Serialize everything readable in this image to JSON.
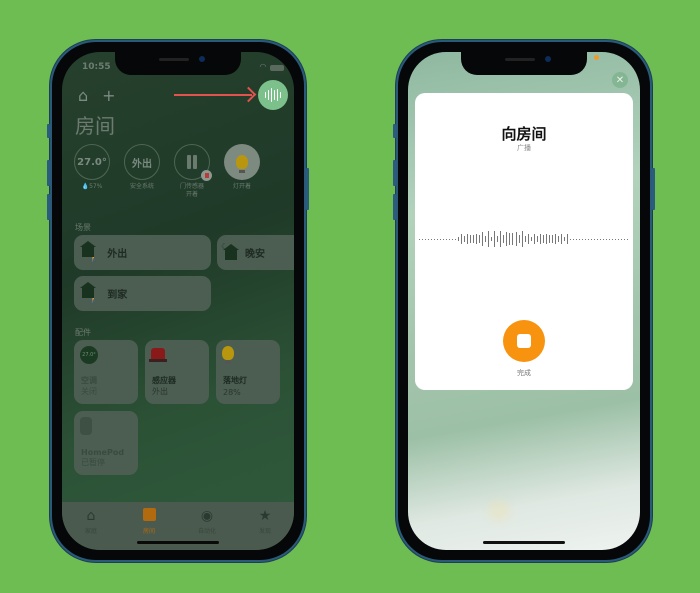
{
  "left_phone": {
    "status_bar": {
      "time": "10:55"
    },
    "header": {
      "home_icon": "house-icon",
      "add_icon": "plus-icon",
      "voice_icon": "waveform-icon",
      "title": "房间"
    },
    "status_items": [
      {
        "value": "27.0°",
        "label": "💧57%"
      },
      {
        "value": "外出",
        "label": "安全系统"
      },
      {
        "value": "",
        "label": "门传感器",
        "label2": "开着",
        "icon": "door-sensor-icon"
      },
      {
        "value": "",
        "label": "灯开着",
        "icon": "bulb-icon"
      }
    ],
    "scenes_header": "场景",
    "scenes": [
      {
        "label": "外出",
        "icon": "home-leave-icon"
      },
      {
        "label": "晚安",
        "icon": "home-night-icon"
      },
      {
        "label": "到家",
        "icon": "home-arrive-icon"
      }
    ],
    "accessories_header": "配件",
    "accessories": [
      {
        "name": "空调",
        "status": "关闭",
        "icon_text": "27.0°"
      },
      {
        "name": "感应器",
        "status": "外出"
      },
      {
        "name": "落地灯",
        "status": "28%"
      },
      {
        "name": "HomePod",
        "status": "已暂停"
      }
    ],
    "tabs": [
      {
        "label": "家庭",
        "icon": "home-tab-icon",
        "active": false
      },
      {
        "label": "房间",
        "icon": "rooms-tab-icon",
        "active": true
      },
      {
        "label": "自动化",
        "icon": "automation-tab-icon",
        "active": false
      },
      {
        "label": "发现",
        "icon": "discover-tab-icon",
        "active": false
      }
    ]
  },
  "right_phone": {
    "close_icon": "close-icon",
    "card": {
      "title": "向房间",
      "subtitle": "广播",
      "stop_label": "完成"
    }
  },
  "colors": {
    "background": "#6dbd52",
    "accent_orange": "#f7930f",
    "voice_green": "#7cc08c",
    "arrow_red": "#e2524e"
  }
}
